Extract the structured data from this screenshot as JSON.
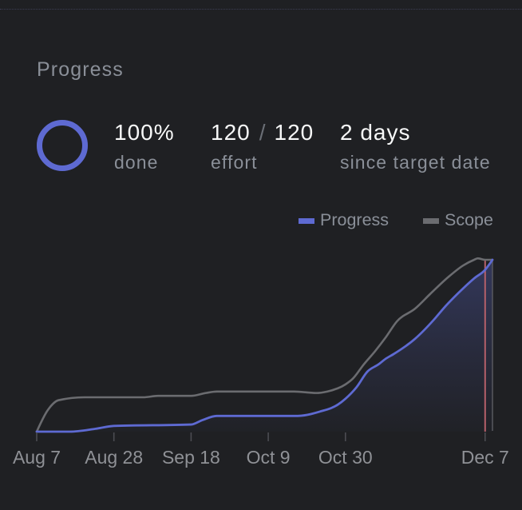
{
  "header": {
    "title": "Progress"
  },
  "ring": {
    "percent": 100,
    "color": "#5e6ad2"
  },
  "stats": {
    "done": {
      "value": "100%",
      "label": "done"
    },
    "effort": {
      "completed": "120",
      "separator": "/",
      "total": "120",
      "label": "effort"
    },
    "since_target": {
      "value": "2 days",
      "label": "since target date"
    }
  },
  "colors": {
    "accent": "#5e6ad2",
    "scope": "#6b6c70",
    "target_line": "#b5606a",
    "today_line": "#55565c",
    "background": "#1f2023"
  },
  "chart_data": {
    "type": "line",
    "title": "",
    "xlabel": "",
    "ylabel": "",
    "grid": false,
    "legend_position": "top-right",
    "x_ticks": [
      "Aug 7",
      "Aug 28",
      "Sep 18",
      "Oct 9",
      "Oct 30",
      "Dec 7"
    ],
    "xlim": [
      "Aug 7",
      "Dec 9"
    ],
    "ylim": [
      0,
      120
    ],
    "target_date": "Dec 7",
    "today": "Dec 9",
    "series": [
      {
        "name": "Progress",
        "color": "#5e6ad2",
        "area_fill": true,
        "points": [
          {
            "x": "Aug 7",
            "y": 0
          },
          {
            "x": "Aug 16",
            "y": 0
          },
          {
            "x": "Aug 23",
            "y": 2
          },
          {
            "x": "Aug 28",
            "y": 4
          },
          {
            "x": "Sep 18",
            "y": 5
          },
          {
            "x": "Sep 21",
            "y": 8
          },
          {
            "x": "Sep 25",
            "y": 11
          },
          {
            "x": "Oct 17",
            "y": 11
          },
          {
            "x": "Oct 23",
            "y": 14
          },
          {
            "x": "Oct 28",
            "y": 19
          },
          {
            "x": "Oct 30",
            "y": 23
          },
          {
            "x": "Nov 2",
            "y": 31
          },
          {
            "x": "Nov 5",
            "y": 42
          },
          {
            "x": "Nov 8",
            "y": 47
          },
          {
            "x": "Nov 10",
            "y": 51
          },
          {
            "x": "Nov 12",
            "y": 54
          },
          {
            "x": "Nov 18",
            "y": 65
          },
          {
            "x": "Nov 23",
            "y": 78
          },
          {
            "x": "Nov 26",
            "y": 87
          },
          {
            "x": "Dec 1",
            "y": 100
          },
          {
            "x": "Dec 4",
            "y": 107
          },
          {
            "x": "Dec 7",
            "y": 113
          },
          {
            "x": "Dec 9",
            "y": 120
          }
        ]
      },
      {
        "name": "Scope",
        "color": "#6b6c70",
        "area_fill": false,
        "points": [
          {
            "x": "Aug 7",
            "y": 0
          },
          {
            "x": "Aug 10",
            "y": 15
          },
          {
            "x": "Aug 13",
            "y": 22
          },
          {
            "x": "Aug 20",
            "y": 24
          },
          {
            "x": "Sep 5",
            "y": 24
          },
          {
            "x": "Sep 9",
            "y": 25
          },
          {
            "x": "Sep 18",
            "y": 25
          },
          {
            "x": "Sep 22",
            "y": 27
          },
          {
            "x": "Sep 25",
            "y": 28
          },
          {
            "x": "Oct 16",
            "y": 28
          },
          {
            "x": "Oct 22",
            "y": 27
          },
          {
            "x": "Oct 25",
            "y": 28
          },
          {
            "x": "Oct 30",
            "y": 33
          },
          {
            "x": "Nov 1",
            "y": 37
          },
          {
            "x": "Nov 4",
            "y": 47
          },
          {
            "x": "Nov 7",
            "y": 56
          },
          {
            "x": "Nov 10",
            "y": 66
          },
          {
            "x": "Nov 13",
            "y": 77
          },
          {
            "x": "Nov 18",
            "y": 86
          },
          {
            "x": "Nov 22",
            "y": 96
          },
          {
            "x": "Nov 27",
            "y": 108
          },
          {
            "x": "Dec 1",
            "y": 116
          },
          {
            "x": "Dec 4",
            "y": 120
          },
          {
            "x": "Dec 5",
            "y": 121
          },
          {
            "x": "Dec 7",
            "y": 120
          },
          {
            "x": "Dec 9",
            "y": 120
          }
        ]
      }
    ]
  }
}
